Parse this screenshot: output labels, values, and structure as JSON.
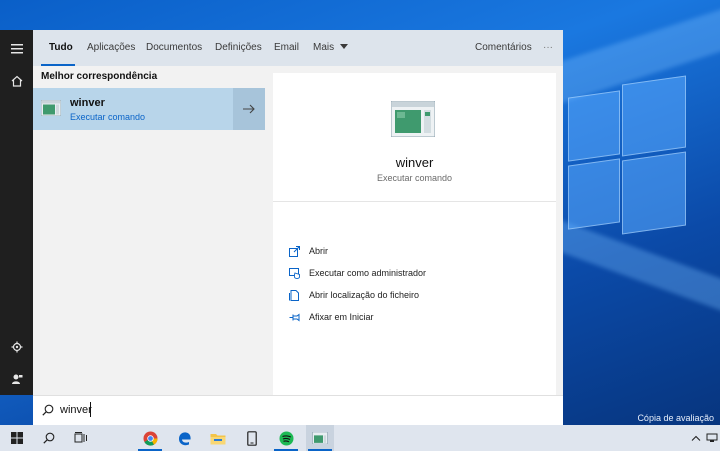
{
  "tabs": [
    {
      "label": "Tudo",
      "active": true
    },
    {
      "label": "Aplicações"
    },
    {
      "label": "Documentos"
    },
    {
      "label": "Definições"
    },
    {
      "label": "Email"
    },
    {
      "label": "Mais"
    }
  ],
  "feedback_label": "Comentários",
  "more_options_label": "···",
  "best_match_heading": "Melhor correspondência",
  "best_match": {
    "title": "winver",
    "subtitle": "Executar comando"
  },
  "detail": {
    "title": "winver",
    "subtitle": "Executar comando",
    "actions": [
      {
        "label": "Abrir",
        "icon": "open-icon"
      },
      {
        "label": "Executar como administrador",
        "icon": "run-as-admin-icon"
      },
      {
        "label": "Abrir localização do ficheiro",
        "icon": "file-location-icon"
      },
      {
        "label": "Afixar em Iniciar",
        "icon": "pin-icon"
      }
    ]
  },
  "search": {
    "value": "winver"
  },
  "watermark": "Cópia de avaliação",
  "colors": {
    "accent": "#0a64c8",
    "selection": "#b8d5ea"
  }
}
